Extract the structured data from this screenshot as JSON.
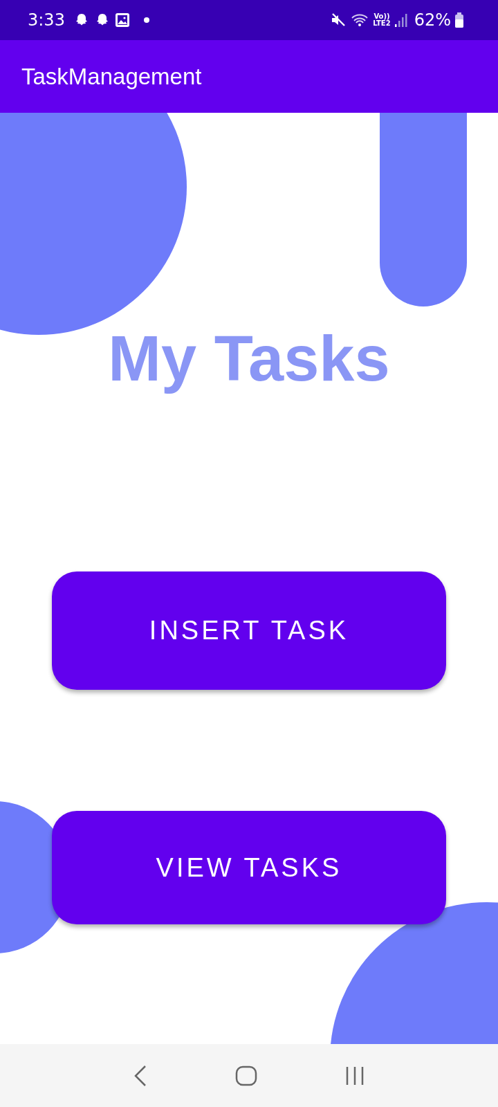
{
  "status_bar": {
    "time": "3:33",
    "volte": "Vo))",
    "network": "LTE2",
    "battery": "62%"
  },
  "app_bar": {
    "title": "TaskManagement"
  },
  "heading": "My Tasks",
  "buttons": [
    {
      "label": "INSERT TASK"
    },
    {
      "label": "VIEW TASKS"
    }
  ]
}
